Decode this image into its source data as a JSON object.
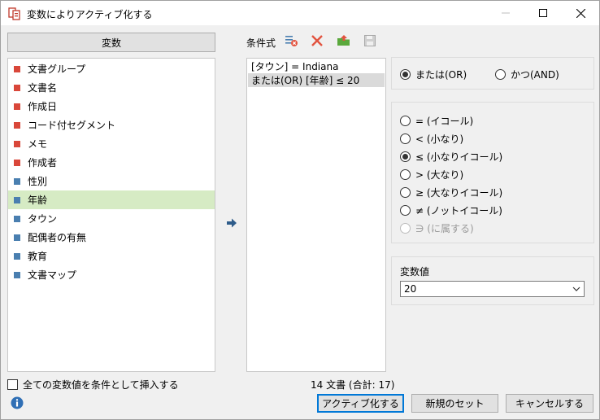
{
  "window": {
    "title": "変数によりアクティブ化する"
  },
  "variables": {
    "header": "変数",
    "items": [
      {
        "label": "文書グループ",
        "color": "#d9473a"
      },
      {
        "label": "文書名",
        "color": "#d9473a"
      },
      {
        "label": "作成日",
        "color": "#d9473a"
      },
      {
        "label": "コード付セグメント",
        "color": "#d9473a"
      },
      {
        "label": "メモ",
        "color": "#d9473a"
      },
      {
        "label": "作成者",
        "color": "#d9473a"
      },
      {
        "label": "性別",
        "color": "#4a7fb0"
      },
      {
        "label": "年齢",
        "color": "#4a7fb0"
      },
      {
        "label": "タウン",
        "color": "#4a7fb0"
      },
      {
        "label": "配偶者の有無",
        "color": "#4a7fb0"
      },
      {
        "label": "教育",
        "color": "#4a7fb0"
      },
      {
        "label": "文書マップ",
        "color": "#4a7fb0"
      }
    ],
    "selected_label": "年齢"
  },
  "conditions": {
    "label": "条件式",
    "items": [
      "[タウン] = Indiana",
      "または(OR) [年齢] ≤ 20"
    ]
  },
  "logic": {
    "or_label": "または(OR)",
    "and_label": "かつ(AND)",
    "selected": "or"
  },
  "operators": {
    "items": [
      {
        "label": "= (イコール)",
        "disabled": false
      },
      {
        "label": "< (小なり)",
        "disabled": false
      },
      {
        "label": "≤ (小なりイコール)",
        "disabled": false
      },
      {
        "label": "> (大なり)",
        "disabled": false
      },
      {
        "label": "≥ (大なりイコール)",
        "disabled": false
      },
      {
        "label": "≠ (ノットイコール)",
        "disabled": false
      },
      {
        "label": "∋ (に属する)",
        "disabled": true
      }
    ],
    "selected_label": "≤ (小なりイコール)"
  },
  "value": {
    "label": "変数値",
    "current": "20"
  },
  "footer": {
    "insert_all_label": "全ての変数値を条件として挿入する",
    "status": "14 文書 (合計: 17)",
    "activate_button": "アクティブ化する",
    "new_set_button": "新規のセット",
    "cancel_button": "キャンセルする"
  },
  "colors": {
    "selection_green": "#d6ebc4",
    "accent_blue": "#0078d7",
    "arrow_blue": "#2e5c8a"
  }
}
